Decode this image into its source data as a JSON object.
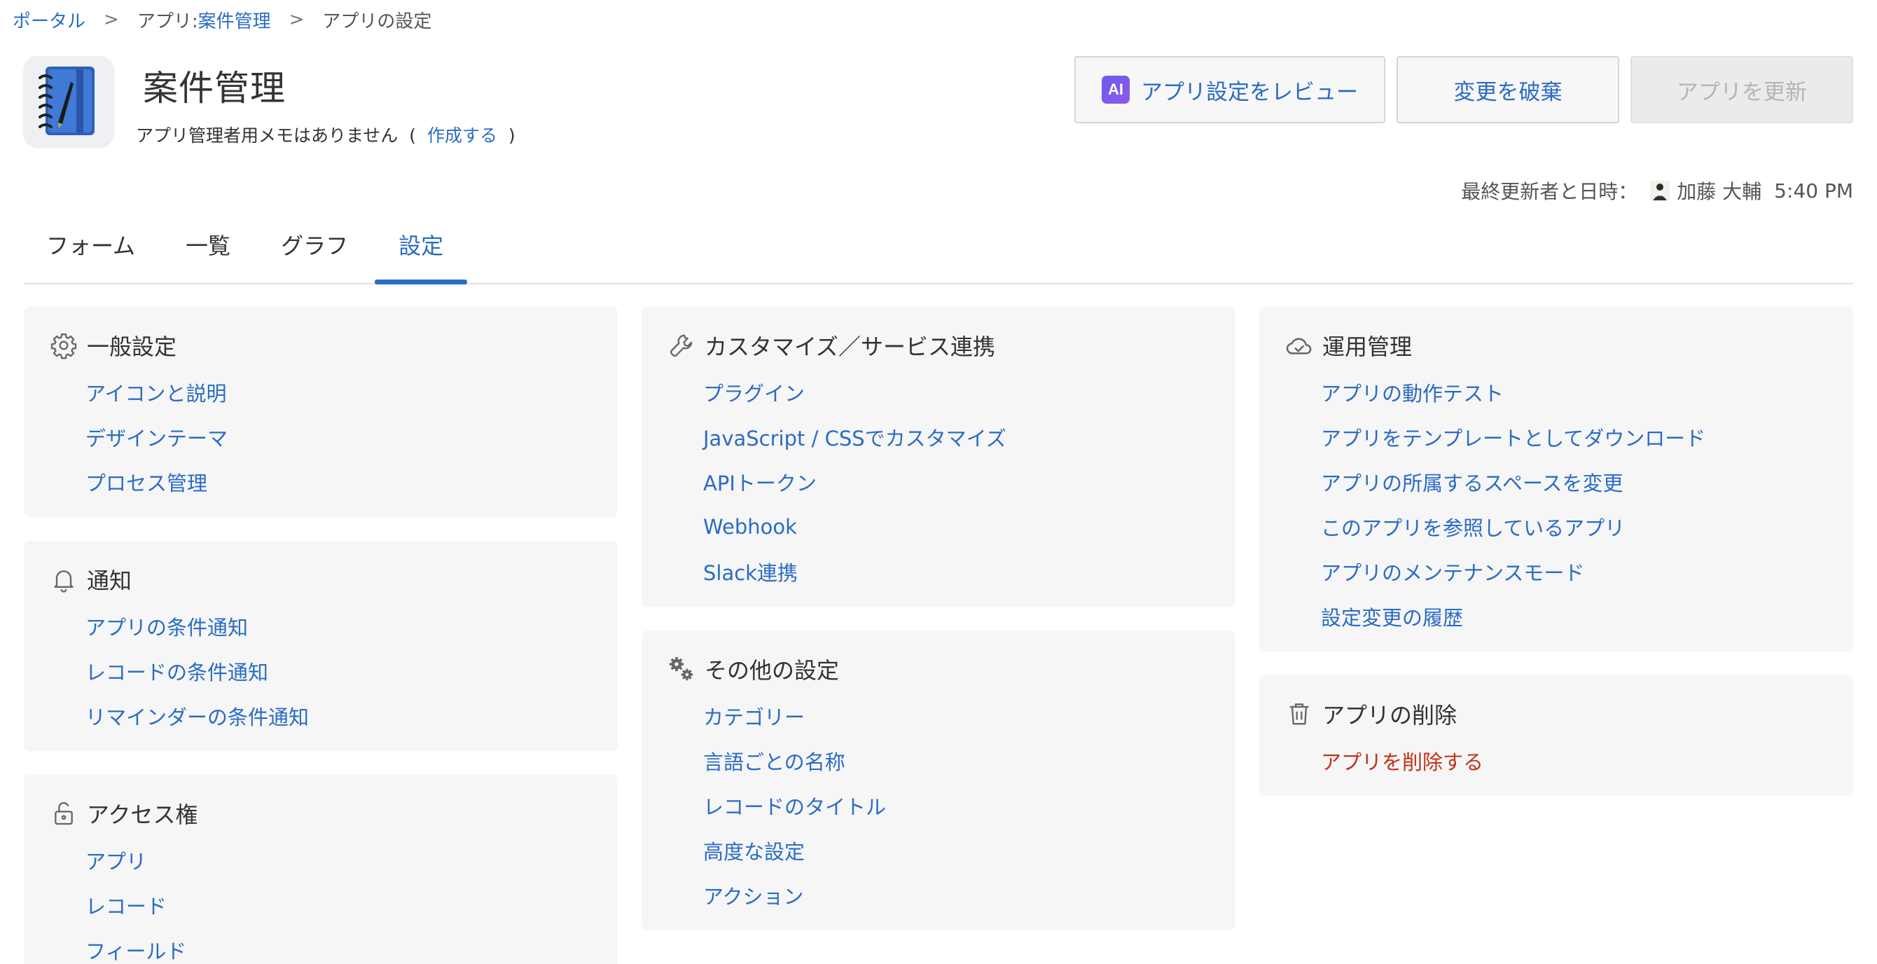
{
  "breadcrumb": {
    "portal": "ポータル",
    "app_prefix": "アプリ: ",
    "app_link": "案件管理",
    "current": "アプリの設定",
    "separator": ">"
  },
  "app": {
    "title": "案件管理",
    "memo_text": "アプリ管理者用メモはありません",
    "memo_open": "(",
    "memo_link": "作成する",
    "memo_close": ")",
    "icon": "notebook-icon"
  },
  "buttons": {
    "ai_badge": "AI",
    "review": "アプリ設定をレビュー",
    "discard": "変更を破棄",
    "update": "アプリを更新"
  },
  "last_updated": {
    "label": "最終更新者と日時：",
    "user": "加藤 大輔",
    "time": "5:40 PM"
  },
  "tabs": [
    {
      "label": "フォーム",
      "active": false
    },
    {
      "label": "一覧",
      "active": false
    },
    {
      "label": "グラフ",
      "active": false
    },
    {
      "label": "設定",
      "active": true
    }
  ],
  "sections": {
    "general": {
      "title": "一般設定",
      "icon": "gear-icon",
      "items": [
        "アイコンと説明",
        "デザインテーマ",
        "プロセス管理"
      ]
    },
    "notification": {
      "title": "通知",
      "icon": "bell-icon",
      "items": [
        "アプリの条件通知",
        "レコードの条件通知",
        "リマインダーの条件通知"
      ]
    },
    "access": {
      "title": "アクセス権",
      "icon": "unlock-icon",
      "items": [
        "アプリ",
        "レコード",
        "フィールド"
      ]
    },
    "customize": {
      "title": "カスタマイズ／サービス連携",
      "icon": "wrench-icon",
      "items": [
        "プラグイン",
        "JavaScript / CSSでカスタマイズ",
        "APIトークン",
        "Webhook",
        "Slack連携"
      ]
    },
    "other": {
      "title": "その他の設定",
      "icon": "gears-icon",
      "items": [
        "カテゴリー",
        "言語ごとの名称",
        "レコードのタイトル",
        "高度な設定",
        "アクション"
      ]
    },
    "operation": {
      "title": "運用管理",
      "icon": "cloud-check-icon",
      "items": [
        "アプリの動作テスト",
        "アプリをテンプレートとしてダウンロード",
        "アプリの所属するスペースを変更",
        "このアプリを参照しているアプリ",
        "アプリのメンテナンスモード",
        "設定変更の履歴"
      ]
    },
    "delete": {
      "title": "アプリの削除",
      "icon": "trash-icon",
      "items": [
        "アプリを削除する"
      ]
    }
  },
  "colors": {
    "link": "#2b6cc4",
    "danger": "#c0321a",
    "card_bg": "#f6f6f6",
    "ai_badge": "#7a5af0"
  }
}
